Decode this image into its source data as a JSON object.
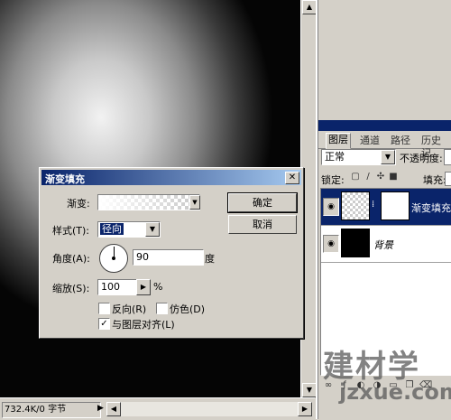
{
  "status": {
    "doc_size": "732.4K/0 字节"
  },
  "layers_panel": {
    "tabs": [
      "图层",
      "通道",
      "路径",
      "历史记"
    ],
    "blend_mode": "正常",
    "opacity_label": "不透明度:",
    "lock_label": "锁定:",
    "fill_label": "填充:",
    "layers": [
      {
        "name": "渐变填充",
        "selected": true
      },
      {
        "name": "背景",
        "selected": false
      }
    ]
  },
  "watermark": {
    "cn": "建材学",
    "en": "jzxue.com"
  },
  "dialog": {
    "title": "渐变填充",
    "gradient_label": "渐变:",
    "style_label": "样式(T):",
    "style_value": "径向",
    "angle_label": "角度(A):",
    "angle_value": "90",
    "angle_unit": "度",
    "scale_label": "缩放(S):",
    "scale_value": "100",
    "scale_unit": "%",
    "reverse_label": "反向(R)",
    "reverse_checked": false,
    "dither_label": "仿色(D)",
    "dither_checked": false,
    "align_label": "与图层对齐(L)",
    "align_checked": true,
    "ok_label": "确定",
    "cancel_label": "取消"
  }
}
